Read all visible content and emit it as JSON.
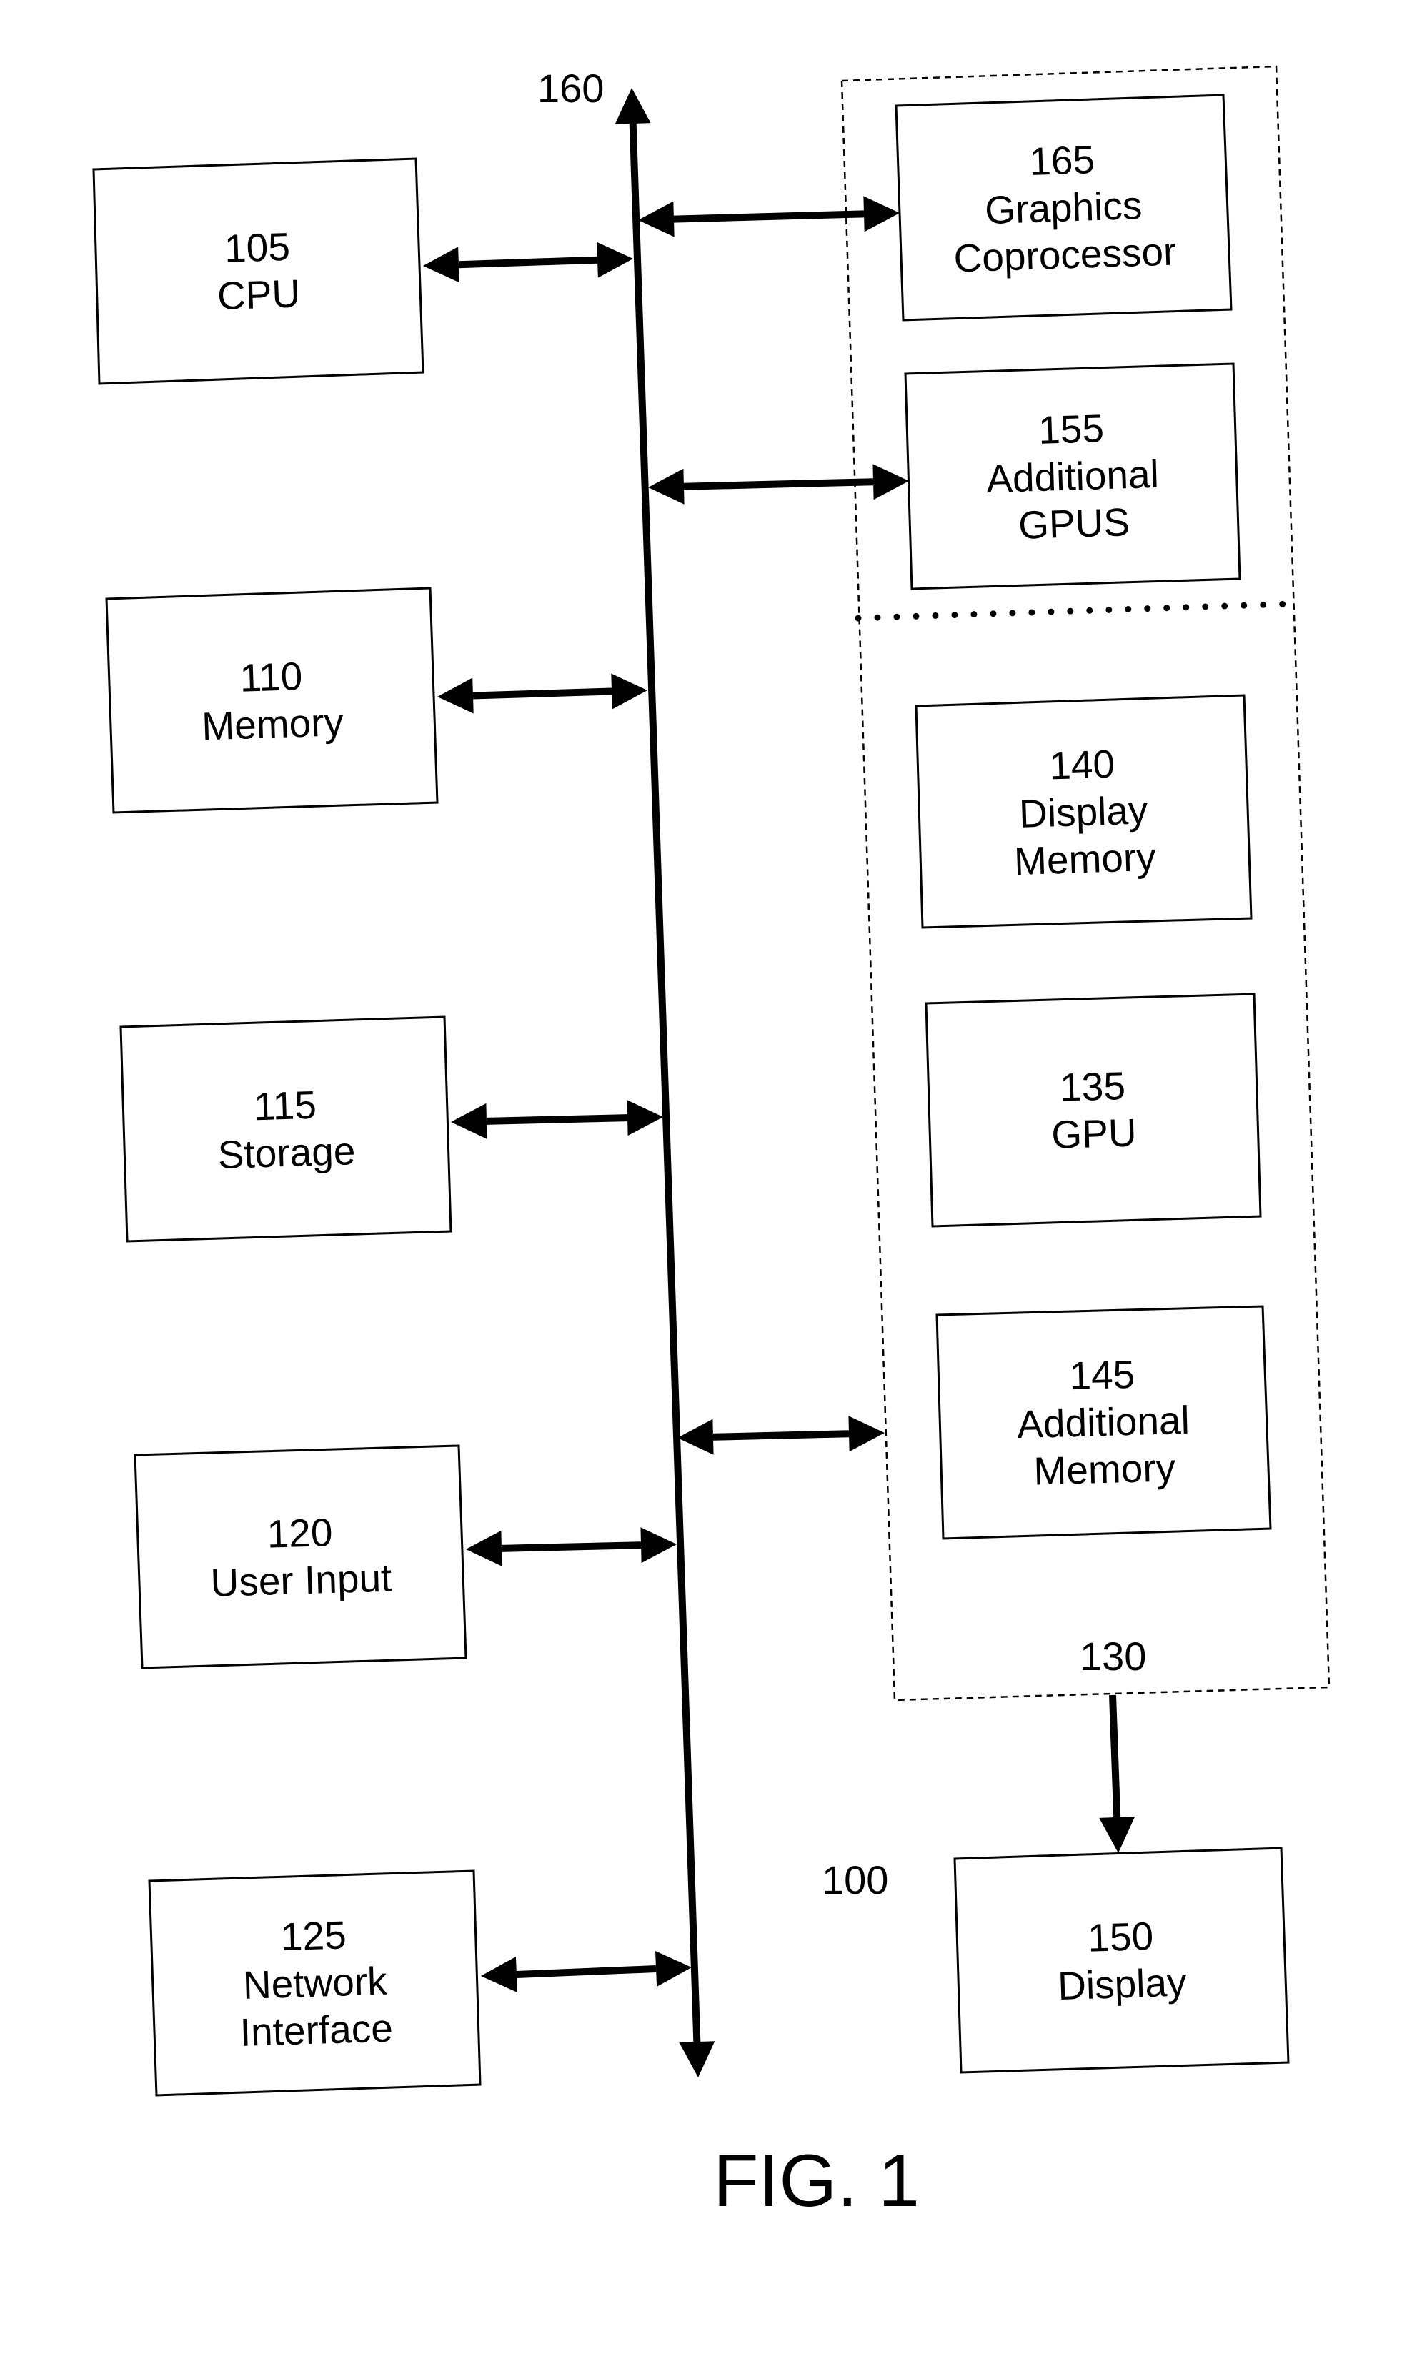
{
  "figure": {
    "title": "FIG. 1",
    "system_ref": "100",
    "bus_ref": "160",
    "graphics_subsystem_ref": "130"
  },
  "components": {
    "cpu": {
      "ref": "105",
      "lines": [
        "CPU"
      ]
    },
    "memory": {
      "ref": "110",
      "lines": [
        "Memory"
      ]
    },
    "storage": {
      "ref": "115",
      "lines": [
        "Storage"
      ]
    },
    "user_input": {
      "ref": "120",
      "lines": [
        "User Input"
      ]
    },
    "network_interface": {
      "ref": "125",
      "lines": [
        "Network",
        "Interface"
      ]
    },
    "graphics_coprocessor": {
      "ref": "165",
      "lines": [
        "Graphics",
        "Coprocessor"
      ]
    },
    "additional_gpus": {
      "ref": "155",
      "lines": [
        "Additional",
        "GPUS"
      ]
    },
    "display_memory": {
      "ref": "140",
      "lines": [
        "Display",
        "Memory"
      ]
    },
    "gpu": {
      "ref": "135",
      "lines": [
        "GPU"
      ]
    },
    "additional_memory": {
      "ref": "145",
      "lines": [
        "Additional",
        "Memory"
      ]
    },
    "display": {
      "ref": "150",
      "lines": [
        "Display"
      ]
    }
  },
  "connections": [
    {
      "from": "cpu",
      "to": "bus",
      "type": "bidirectional"
    },
    {
      "from": "memory",
      "to": "bus",
      "type": "bidirectional"
    },
    {
      "from": "storage",
      "to": "bus",
      "type": "bidirectional"
    },
    {
      "from": "user_input",
      "to": "bus",
      "type": "bidirectional"
    },
    {
      "from": "network_interface",
      "to": "bus",
      "type": "bidirectional"
    },
    {
      "from": "bus",
      "to": "graphics_coprocessor",
      "type": "bidirectional"
    },
    {
      "from": "bus",
      "to": "additional_gpus",
      "type": "bidirectional"
    },
    {
      "from": "bus",
      "to": "graphics_subsystem",
      "type": "bidirectional"
    },
    {
      "from": "graphics_subsystem",
      "to": "display",
      "type": "unidirectional"
    }
  ]
}
